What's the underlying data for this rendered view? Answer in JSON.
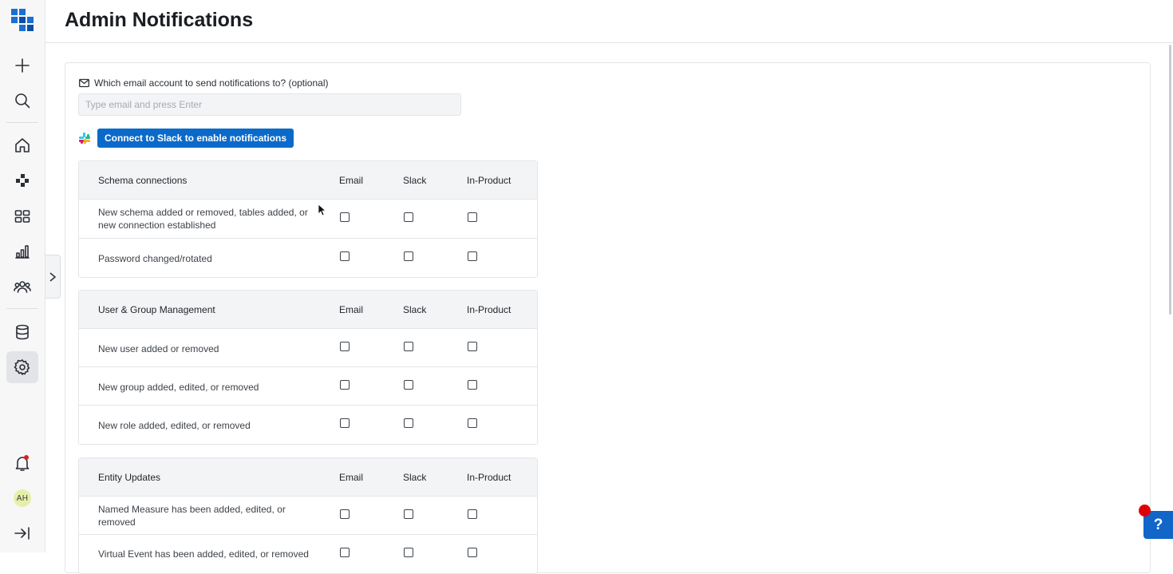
{
  "header": {
    "title": "Admin Notifications"
  },
  "sidebar": {
    "items": [
      {
        "name": "new",
        "icon": "plus-icon"
      },
      {
        "name": "search",
        "icon": "search-icon"
      },
      {
        "name": "home",
        "icon": "home-icon"
      },
      {
        "name": "integrations",
        "icon": "puzzle-icon"
      },
      {
        "name": "dashboards",
        "icon": "grid-icon"
      },
      {
        "name": "analytics",
        "icon": "bar-chart-icon"
      },
      {
        "name": "users",
        "icon": "users-icon"
      },
      {
        "name": "data",
        "icon": "database-icon"
      },
      {
        "name": "settings",
        "icon": "gear-icon",
        "active": true
      },
      {
        "name": "notifications",
        "icon": "bell-icon"
      },
      {
        "name": "expand",
        "icon": "expand-icon"
      }
    ],
    "avatar_initials": "AH"
  },
  "email": {
    "label": "Which email account to send notifications to? (optional)",
    "placeholder": "Type email and press Enter",
    "value": ""
  },
  "slack": {
    "button_label": "Connect to Slack to enable notifications"
  },
  "columns": {
    "email": "Email",
    "slack": "Slack",
    "in_product": "In-Product"
  },
  "sections": [
    {
      "title": "Schema connections",
      "rows": [
        {
          "label": "New schema added or removed, tables added, or new connection established",
          "email": false,
          "slack": false,
          "in_product": false
        },
        {
          "label": "Password changed/rotated",
          "email": false,
          "slack": false,
          "in_product": false
        }
      ]
    },
    {
      "title": "User & Group Management",
      "rows": [
        {
          "label": "New user added or removed",
          "email": false,
          "slack": false,
          "in_product": false
        },
        {
          "label": "New group added, edited, or removed",
          "email": false,
          "slack": false,
          "in_product": false
        },
        {
          "label": "New role added, edited, or removed",
          "email": false,
          "slack": false,
          "in_product": false
        }
      ]
    },
    {
      "title": "Entity Updates",
      "rows": [
        {
          "label": "Named Measure has been added, edited, or removed",
          "email": false,
          "slack": false,
          "in_product": false
        },
        {
          "label": "Virtual Event has been added, edited, or removed",
          "email": false,
          "slack": false,
          "in_product": false
        }
      ]
    }
  ],
  "colors": {
    "accent": "#0b6ac9",
    "help": "#1166c7",
    "alert": "#e00000"
  }
}
